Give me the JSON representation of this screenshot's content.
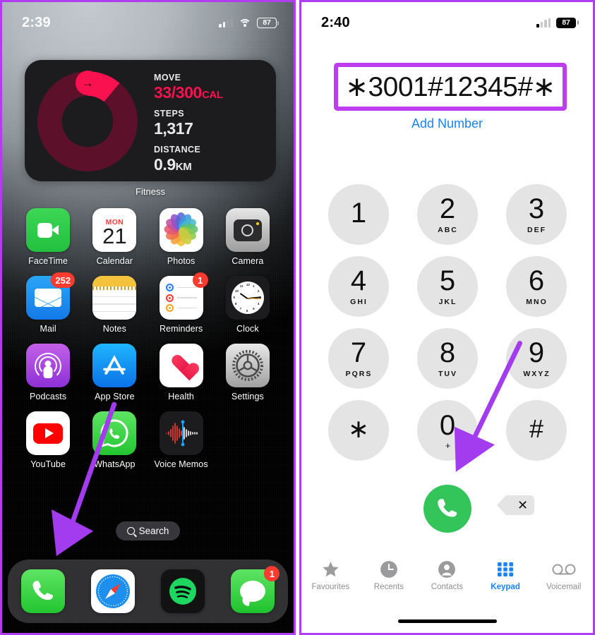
{
  "left_phone": {
    "status": {
      "time": "2:39",
      "battery": "87",
      "signal_icon": "cellular-bars-icon",
      "wifi_icon": "wifi-icon",
      "battery_icon": "battery-icon"
    },
    "widget": {
      "name": "Fitness",
      "move_label": "MOVE",
      "move_value": "33/300",
      "move_unit": "CAL",
      "steps_label": "STEPS",
      "steps_value": "1,317",
      "distance_label": "DISTANCE",
      "distance_value": "0.9",
      "distance_unit": "KM",
      "ring_arrow": "→",
      "ring_color": "#fa114f",
      "ring_track_color": "#5c1029"
    },
    "apps": [
      [
        {
          "label": "FaceTime",
          "icon": "facetime-icon",
          "badge": null
        },
        {
          "label": "Calendar",
          "icon": "calendar-icon",
          "badge": null,
          "dow": "MON",
          "day": "21"
        },
        {
          "label": "Photos",
          "icon": "photos-icon",
          "badge": null
        },
        {
          "label": "Camera",
          "icon": "camera-icon",
          "badge": null
        }
      ],
      [
        {
          "label": "Mail",
          "icon": "mail-icon",
          "badge": "252"
        },
        {
          "label": "Notes",
          "icon": "notes-icon",
          "badge": null
        },
        {
          "label": "Reminders",
          "icon": "reminders-icon",
          "badge": "1"
        },
        {
          "label": "Clock",
          "icon": "clock-icon",
          "badge": null
        }
      ],
      [
        {
          "label": "Podcasts",
          "icon": "podcasts-icon",
          "badge": null
        },
        {
          "label": "App Store",
          "icon": "app-store-icon",
          "badge": null
        },
        {
          "label": "Health",
          "icon": "health-icon",
          "badge": null
        },
        {
          "label": "Settings",
          "icon": "settings-icon",
          "badge": null
        }
      ],
      [
        {
          "label": "YouTube",
          "icon": "youtube-icon",
          "badge": null
        },
        {
          "label": "WhatsApp",
          "icon": "whatsapp-icon",
          "badge": null
        },
        {
          "label": "Voice Memos",
          "icon": "voice-memos-icon",
          "badge": null
        },
        {
          "label": "",
          "icon": "empty",
          "badge": null
        }
      ]
    ],
    "search": {
      "label": "Search",
      "icon": "search-icon"
    },
    "dock": [
      {
        "label": "Phone",
        "icon": "phone-icon",
        "badge": null
      },
      {
        "label": "Safari",
        "icon": "safari-icon",
        "badge": null
      },
      {
        "label": "Spotify",
        "icon": "spotify-icon",
        "badge": null
      },
      {
        "label": "Messages",
        "icon": "messages-icon",
        "badge": "1"
      }
    ]
  },
  "right_phone": {
    "status": {
      "time": "2:40",
      "battery": "87",
      "signal_icon": "cellular-bars-icon",
      "battery_icon": "battery-icon"
    },
    "dialer": {
      "number": "∗3001#12345#∗",
      "add_number": "Add Number",
      "call_icon": "phone-call-icon",
      "delete_icon": "backspace-icon",
      "delete_glyph": "✕"
    },
    "keys": [
      {
        "digit": "1",
        "letters": ""
      },
      {
        "digit": "2",
        "letters": "ABC"
      },
      {
        "digit": "3",
        "letters": "DEF"
      },
      {
        "digit": "4",
        "letters": "GHI"
      },
      {
        "digit": "5",
        "letters": "JKL"
      },
      {
        "digit": "6",
        "letters": "MNO"
      },
      {
        "digit": "7",
        "letters": "PQRS"
      },
      {
        "digit": "8",
        "letters": "TUV"
      },
      {
        "digit": "9",
        "letters": "WXYZ"
      },
      {
        "digit": "∗",
        "letters": ""
      },
      {
        "digit": "0",
        "letters": "+"
      },
      {
        "digit": "#",
        "letters": ""
      }
    ],
    "tabs": [
      {
        "label": "Favourites",
        "icon": "star-icon",
        "active": false
      },
      {
        "label": "Recents",
        "icon": "clock-icon",
        "active": false
      },
      {
        "label": "Contacts",
        "icon": "person-icon",
        "active": false
      },
      {
        "label": "Keypad",
        "icon": "keypad-icon",
        "active": true
      },
      {
        "label": "Voicemail",
        "icon": "voicemail-icon",
        "active": false
      }
    ]
  },
  "annotations": {
    "arrow_color": "#a33bef",
    "highlight_color": "#bd3ef0",
    "arrow_left": "arrow-pointing-to-phone-app",
    "arrow_right": "arrow-pointing-to-call-button"
  }
}
